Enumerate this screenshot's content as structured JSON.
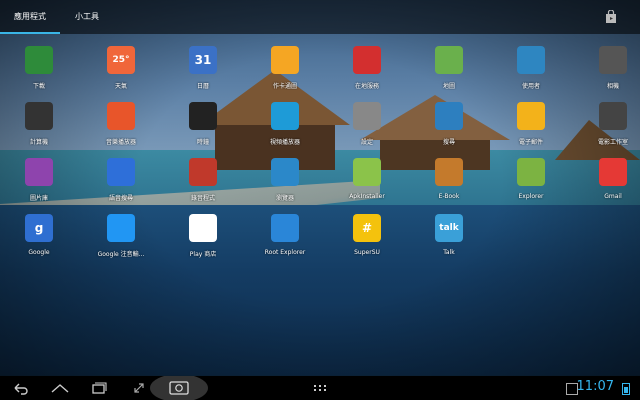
{
  "tabs": [
    {
      "label": "應用程式",
      "active": true
    },
    {
      "label": "小工具",
      "active": false
    }
  ],
  "apps": [
    {
      "label": "下載",
      "icon": "download-icon",
      "color": "#2e8b3a"
    },
    {
      "label": "天氣",
      "icon": "weather-icon",
      "color": "#f0663a",
      "glyph": "25°"
    },
    {
      "label": "日曆",
      "icon": "calendar-icon",
      "color": "#3b71c6",
      "glyph": "31"
    },
    {
      "label": "作卡通圖",
      "icon": "cartoon-icon",
      "color": "#f5a623"
    },
    {
      "label": "在地服務",
      "icon": "places-icon",
      "color": "#d32f2f"
    },
    {
      "label": "地圖",
      "icon": "maps-icon",
      "color": "#6ab04c"
    },
    {
      "label": "使用者",
      "icon": "people-icon",
      "color": "#2e86c1"
    },
    {
      "label": "相機",
      "icon": "camera-icon",
      "color": "#555555"
    },
    {
      "label": "計算機",
      "icon": "calculator-icon",
      "color": "#333333"
    },
    {
      "label": "音樂播放器",
      "icon": "music-icon",
      "color": "#e8552a"
    },
    {
      "label": "時鐘",
      "icon": "clock-icon",
      "color": "#222222"
    },
    {
      "label": "視頻播放器",
      "icon": "video-player-icon",
      "color": "#1e9bd7"
    },
    {
      "label": "設定",
      "icon": "settings-gear-icon",
      "color": "#888888"
    },
    {
      "label": "搜尋",
      "icon": "search-icon",
      "color": "#2d7fbf"
    },
    {
      "label": "電子郵件",
      "icon": "email-icon",
      "color": "#f3b21a"
    },
    {
      "label": "電影工作室",
      "icon": "movie-studio-icon",
      "color": "#444444"
    },
    {
      "label": "圖片庫",
      "icon": "gallery-icon",
      "color": "#8e44ad"
    },
    {
      "label": "語音搜尋",
      "icon": "voice-search-icon",
      "color": "#2e6fd9"
    },
    {
      "label": "錄音程式",
      "icon": "sound-recorder-icon",
      "color": "#c0392b"
    },
    {
      "label": "瀏覽器",
      "icon": "browser-globe-icon",
      "color": "#2b88c9"
    },
    {
      "label": "ApkInstaller",
      "icon": "apk-installer-icon",
      "color": "#8bc34a"
    },
    {
      "label": "E-Book",
      "icon": "ebook-icon",
      "color": "#c47a2c"
    },
    {
      "label": "Explorer",
      "icon": "explorer-icon",
      "color": "#7cb342"
    },
    {
      "label": "Gmail",
      "icon": "gmail-icon",
      "color": "#e53935"
    },
    {
      "label": "Google",
      "icon": "google-search-icon",
      "color": "#2f6fd1",
      "glyph": "g"
    },
    {
      "label": "Google 注音輸...",
      "icon": "google-zhuyin-input-icon",
      "color": "#2196f3"
    },
    {
      "label": "Play 商店",
      "icon": "play-store-icon",
      "color": "#ffffff"
    },
    {
      "label": "Root Explorer",
      "icon": "root-explorer-icon",
      "color": "#2a86d8"
    },
    {
      "label": "SuperSU",
      "icon": "supersu-icon",
      "color": "#f4c20d",
      "glyph": "#"
    },
    {
      "label": "Talk",
      "icon": "talk-icon",
      "color": "#3aa0d8",
      "glyph": "talk"
    }
  ],
  "status": {
    "time": "11:07"
  },
  "accent_color": "#35b6ef"
}
